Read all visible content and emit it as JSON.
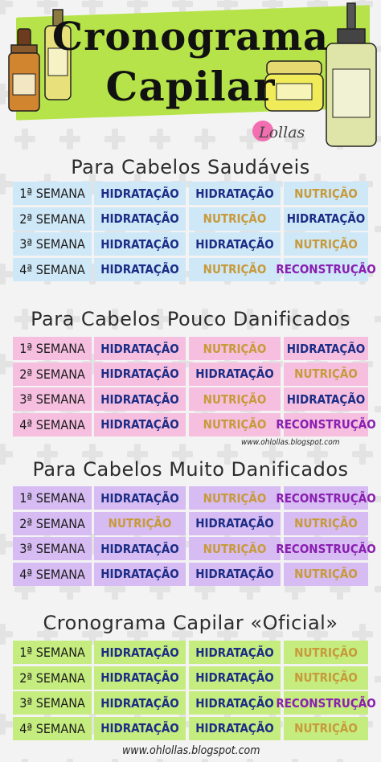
{
  "title": {
    "line1": "Cronograma",
    "line2": "Capilar"
  },
  "brand": "Lollas",
  "watermarks": {
    "middle": "www.ohlollas.blogspot.com",
    "bottom": "www.ohlollas.blogspot.com"
  },
  "colors": {
    "banner": "#b6e34a",
    "hidratacao": "#1c2d86",
    "nutricao": "#c79a3b",
    "reconstrucao": "#8a1fb1",
    "blue": "#cfe8f7",
    "pink": "#f6bfe0",
    "purple": "#d6bcf2",
    "green": "#c5ec7e"
  },
  "sections": [
    {
      "title": "Para Cabelos Saudáveis",
      "rows": [
        {
          "week": "1ª SEMANA",
          "c1": "HIDRATAÇÃO",
          "c2": "HIDRATAÇÃO",
          "c3": "NUTRIÇÃO"
        },
        {
          "week": "2ª SEMANA",
          "c1": "HIDRATAÇÃO",
          "c2": "NUTRIÇÃO",
          "c3": "HIDRATAÇÃO"
        },
        {
          "week": "3ª SEMANA",
          "c1": "HIDRATAÇÃO",
          "c2": "HIDRATAÇÃO",
          "c3": "NUTRIÇÃO"
        },
        {
          "week": "4ª SEMANA",
          "c1": "HIDRATAÇÃO",
          "c2": "NUTRIÇÃO",
          "c3": "RECONSTRUÇÃO"
        }
      ]
    },
    {
      "title": "Para Cabelos Pouco Danificados",
      "rows": [
        {
          "week": "1ª SEMANA",
          "c1": "HIDRATAÇÃO",
          "c2": "NUTRIÇÃO",
          "c3": "HIDRATAÇÃO"
        },
        {
          "week": "2ª SEMANA",
          "c1": "HIDRATAÇÃO",
          "c2": "HIDRATAÇÃO",
          "c3": "NUTRIÇÃO"
        },
        {
          "week": "3ª SEMANA",
          "c1": "HIDRATAÇÃO",
          "c2": "NUTRIÇÃO",
          "c3": "HIDRATAÇÃO"
        },
        {
          "week": "4ª SEMANA",
          "c1": "HIDRATAÇÃO",
          "c2": "NUTRIÇÃO",
          "c3": "RECONSTRUÇÃO"
        }
      ]
    },
    {
      "title": "Para Cabelos Muito Danificados",
      "rows": [
        {
          "week": "1ª SEMANA",
          "c1": "HIDRATAÇÃO",
          "c2": "NUTRIÇÃO",
          "c3": "RECONSTRUÇÃO"
        },
        {
          "week": "2ª SEMANA",
          "c1": "NUTRIÇÃO",
          "c2": "HIDRATAÇÃO",
          "c3": "NUTRIÇÃO"
        },
        {
          "week": "3ª SEMANA",
          "c1": "HIDRATAÇÃO",
          "c2": "NUTRIÇÃO",
          "c3": "RECONSTRUÇÃO"
        },
        {
          "week": "4ª SEMANA",
          "c1": "HIDRATAÇÃO",
          "c2": "HIDRATAÇÃO",
          "c3": "NUTRIÇÃO"
        }
      ]
    },
    {
      "title": "Cronograma Capilar «Oficial»",
      "rows": [
        {
          "week": "1ª SEMANA",
          "c1": "HIDRATAÇÃO",
          "c2": "HIDRATAÇÃO",
          "c3": "NUTRIÇÃO"
        },
        {
          "week": "2ª SEMANA",
          "c1": "HIDRATAÇÃO",
          "c2": "HIDRATAÇÃO",
          "c3": "NUTRIÇÃO"
        },
        {
          "week": "3ª SEMANA",
          "c1": "HIDRATAÇÃO",
          "c2": "HIDRATAÇÃO",
          "c3": "RECONSTRUÇÃO"
        },
        {
          "week": "4ª SEMANA",
          "c1": "HIDRATAÇÃO",
          "c2": "HIDRATAÇÃO",
          "c3": "NUTRIÇÃO"
        }
      ]
    }
  ]
}
